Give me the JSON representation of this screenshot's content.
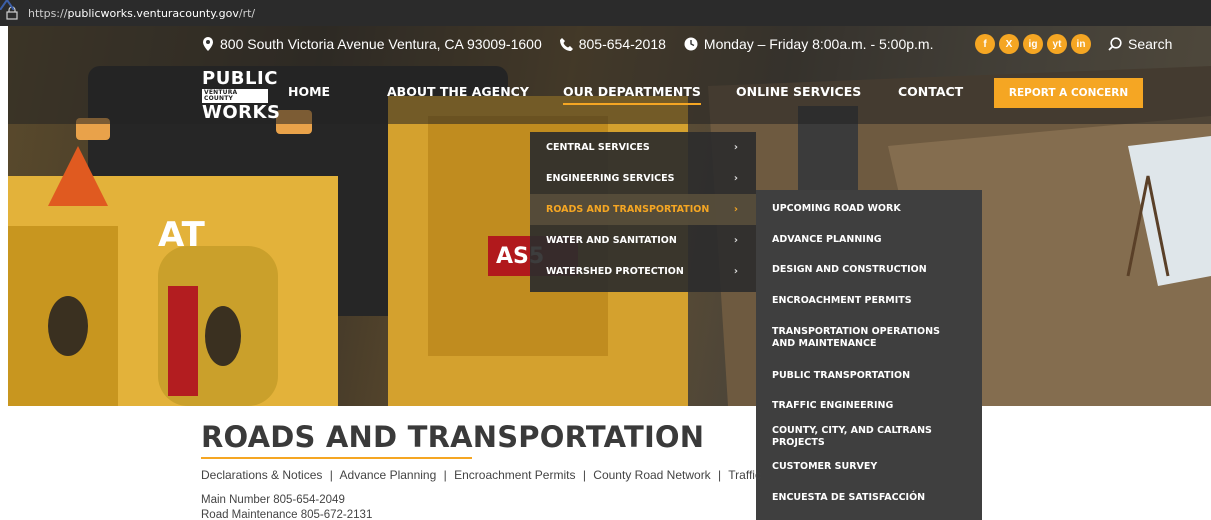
{
  "browser": {
    "url_prefix": "https://",
    "url_domain": "publicworks.venturacounty.gov",
    "url_path": "/rt/"
  },
  "topbar": {
    "address": "800 South Victoria Avenue Ventura, CA 93009-1600",
    "phone": "805-654-2018",
    "hours": "Monday – Friday 8:00a.m. - 5:00p.m.",
    "social": [
      "f",
      "X",
      "ig",
      "yt",
      "in"
    ],
    "search_label": "Search"
  },
  "logo": {
    "line1": "PUBLIC",
    "line2": "VENTURA COUNTY",
    "line3": "WORKS"
  },
  "nav": {
    "home": "HOME",
    "about": "ABOUT THE AGENCY",
    "departments": "OUR DEPARTMENTS",
    "online": "ONLINE SERVICES",
    "contact": "CONTACT",
    "report": "REPORT A CONCERN"
  },
  "dropdown_primary": [
    "CENTRAL SERVICES",
    "ENGINEERING SERVICES",
    "ROADS AND TRANSPORTATION",
    "WATER AND SANITATION",
    "WATERSHED PROTECTION"
  ],
  "chevron": "›",
  "dropdown_secondary": [
    "UPCOMING ROAD WORK",
    "ADVANCE PLANNING",
    "DESIGN AND CONSTRUCTION",
    "ENCROACHMENT PERMITS",
    "TRANSPORTATION OPERATIONS AND MAINTENANCE",
    "PUBLIC TRANSPORTATION",
    "TRAFFIC ENGINEERING",
    "COUNTY, CITY, AND CALTRANS PROJECTS",
    "CUSTOMER SURVEY",
    "ENCUESTA DE SATISFACCIÓN"
  ],
  "page": {
    "title": "ROADS AND TRANSPORTATION",
    "links": [
      "Declarations & Notices",
      "Advance Planning",
      "Encroachment Permits",
      "County Road Network",
      "Traffic"
    ],
    "separator": "|",
    "main_number": "Main Number 805-654-2049",
    "road_maintenance": "Road Maintenance 805-672-2131"
  },
  "colors": {
    "accent": "#f5a623",
    "dark_menu": "#3f3f3f",
    "title_text": "#3a3a3a"
  }
}
